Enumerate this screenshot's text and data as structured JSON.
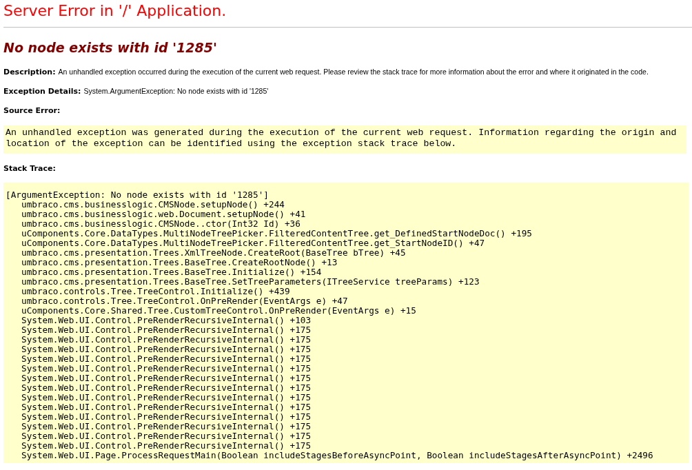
{
  "title": "Server Error in '/' Application.",
  "error_heading": "No node exists with id '1285'",
  "description": {
    "label": "Description:",
    "text": "An unhandled exception occurred during the execution of the current web request. Please review the stack trace for more information about the error and where it originated in the code."
  },
  "exception_details": {
    "label": "Exception Details:",
    "text": "System.ArgumentException: No node exists with id '1285'"
  },
  "source_error": {
    "label": "Source Error:",
    "lines": [
      "An unhandled exception was generated during the execution of the current web request. Information regarding the origin and",
      "location of the exception can be identified using the exception stack trace below."
    ]
  },
  "stack_trace": {
    "label": "Stack Trace:",
    "header": "[ArgumentException: No node exists with id '1285']",
    "frames": [
      "umbraco.cms.businesslogic.CMSNode.setupNode() +244",
      "umbraco.cms.businesslogic.web.Document.setupNode() +41",
      "umbraco.cms.businesslogic.CMSNode..ctor(Int32 Id) +36",
      "uComponents.Core.DataTypes.MultiNodeTreePicker.FilteredContentTree.get_DefinedStartNodeDoc() +195",
      "uComponents.Core.DataTypes.MultiNodeTreePicker.FilteredContentTree.get_StartNodeID() +47",
      "umbraco.cms.presentation.Trees.XmlTreeNode.CreateRoot(BaseTree bTree) +45",
      "umbraco.cms.presentation.Trees.BaseTree.CreateRootNode() +13",
      "umbraco.cms.presentation.Trees.BaseTree.Initialize() +154",
      "umbraco.cms.presentation.Trees.BaseTree.SetTreeParameters(ITreeService treeParams) +123",
      "umbraco.controls.Tree.TreeControl.Initialize() +439",
      "umbraco.controls.Tree.TreeControl.OnPreRender(EventArgs e) +47",
      "uComponents.Core.Shared.Tree.CustomTreeControl.OnPreRender(EventArgs e) +15",
      "System.Web.UI.Control.PreRenderRecursiveInternal() +103",
      "System.Web.UI.Control.PreRenderRecursiveInternal() +175",
      "System.Web.UI.Control.PreRenderRecursiveInternal() +175",
      "System.Web.UI.Control.PreRenderRecursiveInternal() +175",
      "System.Web.UI.Control.PreRenderRecursiveInternal() +175",
      "System.Web.UI.Control.PreRenderRecursiveInternal() +175",
      "System.Web.UI.Control.PreRenderRecursiveInternal() +175",
      "System.Web.UI.Control.PreRenderRecursiveInternal() +175",
      "System.Web.UI.Control.PreRenderRecursiveInternal() +175",
      "System.Web.UI.Control.PreRenderRecursiveInternal() +175",
      "System.Web.UI.Control.PreRenderRecursiveInternal() +175",
      "System.Web.UI.Control.PreRenderRecursiveInternal() +175",
      "System.Web.UI.Control.PreRenderRecursiveInternal() +175",
      "System.Web.UI.Control.PreRenderRecursiveInternal() +175",
      "System.Web.UI.Page.ProcessRequestMain(Boolean includeStagesBeforeAsyncPoint, Boolean includeStagesAfterAsyncPoint) +2496"
    ]
  }
}
